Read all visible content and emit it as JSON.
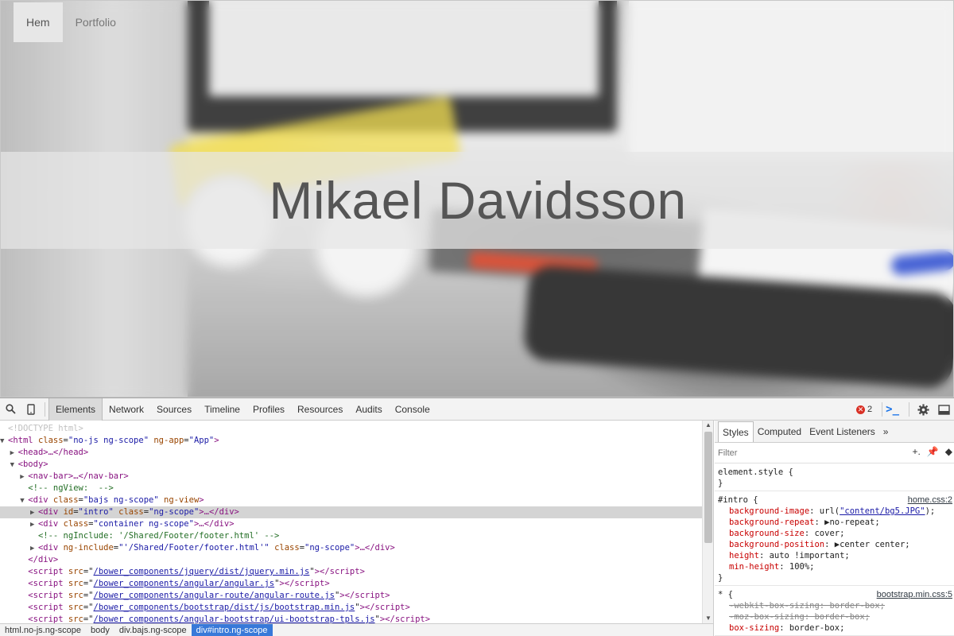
{
  "site": {
    "nav": [
      {
        "label": "Hem",
        "active": true
      },
      {
        "label": "Portfolio",
        "active": false
      }
    ],
    "intro_title": "Mikael Davidsson"
  },
  "devtools": {
    "tabs": [
      "Elements",
      "Network",
      "Sources",
      "Timeline",
      "Profiles",
      "Resources",
      "Audits",
      "Console"
    ],
    "active_tab": "Elements",
    "error_count": "2",
    "tree": {
      "doctype": "<!DOCTYPE html>",
      "html_open": {
        "tag": "<html",
        "attrs": [
          [
            "class",
            "\"no-js ng-scope\""
          ],
          [
            "ng-app",
            "\"App\""
          ]
        ],
        "end": ">"
      },
      "head": "<head>…</head>",
      "body_open": "<body>",
      "navbar": "<nav-bar>…</nav-bar>",
      "comment_ngview": "<!-- ngView:  -->",
      "div_bajs": {
        "tag": "<div",
        "attrs": [
          [
            "class",
            "\"bajs ng-scope\""
          ],
          [
            "ng-view",
            ""
          ]
        ],
        "end": ">"
      },
      "div_intro": {
        "tag": "<div",
        "attrs": [
          [
            "id",
            "\"intro\""
          ],
          [
            "class",
            "\"ng-scope\""
          ]
        ],
        "end": ">…</div>"
      },
      "div_container": {
        "tag": "<div",
        "attrs": [
          [
            "class",
            "\"container ng-scope\""
          ]
        ],
        "end": ">…</div>"
      },
      "comment_nginclude": "<!-- ngInclude: '/Shared/Footer/footer.html' -->",
      "div_footer": {
        "tag": "<div",
        "attrs": [
          [
            "ng-include",
            "\"'/Shared/Footer/footer.html'\""
          ],
          [
            "class",
            "\"ng-scope\""
          ]
        ],
        "end": ">…</div>"
      },
      "div_close": "</div>",
      "scripts": [
        "/bower_components/jquery/dist/jquery.min.js",
        "/bower_components/angular/angular.js",
        "/bower_components/angular-route/angular-route.js",
        "/bower_components/bootstrap/dist/js/bootstrap.min.js",
        "/bower_components/angular-bootstrap/ui-bootstrap-tpls.js"
      ]
    },
    "breadcrumbs": [
      "html.no-js.ng-scope",
      "body",
      "div.bajs.ng-scope",
      "div#intro.ng-scope"
    ],
    "styles": {
      "tabs": [
        "Styles",
        "Computed",
        "Event Listeners"
      ],
      "active_tab": "Styles",
      "more": "»",
      "filter_placeholder": "Filter",
      "element_style_open": "element.style {",
      "element_style_close": "}",
      "rules": [
        {
          "selector": "#intro {",
          "source": "home.css:2",
          "decls": [
            {
              "name": "background-image",
              "value": "url(\"content/bg5.JPG\");",
              "link": "\"content/bg5.JPG\"",
              "strike": false
            },
            {
              "name": "background-repeat",
              "value": "▶no-repeat;",
              "strike": false
            },
            {
              "name": "background-size",
              "value": "cover;",
              "strike": false
            },
            {
              "name": "background-position",
              "value": "▶center center;",
              "strike": false
            },
            {
              "name": "height",
              "value": "auto !important;",
              "strike": false
            },
            {
              "name": "min-height",
              "value": "100%;",
              "strike": false
            }
          ],
          "close": "}"
        },
        {
          "selector": "* {",
          "source": "bootstrap.min.css:5",
          "decls": [
            {
              "name": "-webkit-box-sizing",
              "value": "border-box;",
              "strike": true
            },
            {
              "name": "-moz-box-sizing",
              "value": "border-box;",
              "strike": true
            },
            {
              "name": "box-sizing",
              "value": "border-box;",
              "strike": false
            }
          ]
        }
      ]
    }
  }
}
